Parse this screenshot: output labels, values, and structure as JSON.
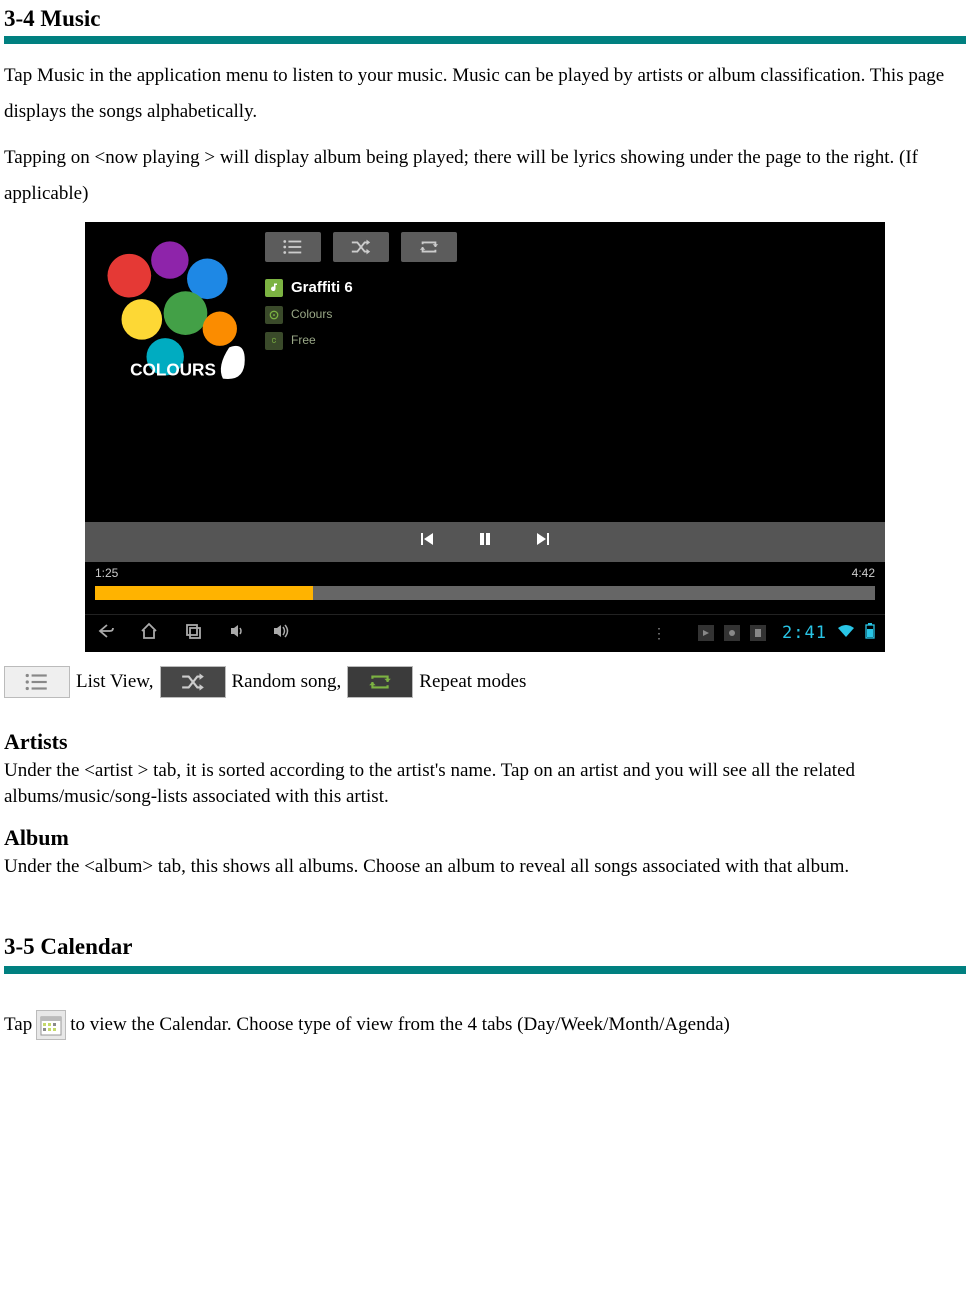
{
  "section1": {
    "title": "3-4 Music",
    "para1": "Tap Music in the application menu to listen to your music. Music can be played by artists or album classification. This page displays the songs alphabetically.",
    "para2": "Tapping on <now playing > will display album being played; there will be lyrics showing under the page to the right. (If applicable)"
  },
  "player": {
    "artist": "Graffiti 6",
    "album": "Colours",
    "track": "Free",
    "time_elapsed": "1:25",
    "time_total": "4:42",
    "clock": "2:41"
  },
  "legend": {
    "list_view": "List View,",
    "random": "Random song,",
    "repeat": "Repeat modes"
  },
  "artists": {
    "heading": "Artists",
    "body": "Under the <artist > tab, it is sorted according to the artist's name. Tap on an artist and you will see all the related albums/music/song-lists associated with this artist."
  },
  "album": {
    "heading": "Album",
    "body": "Under the <album> tab, this shows all albums.    Choose an album to reveal all songs associated with that album."
  },
  "section2": {
    "title": "3-5 Calendar",
    "line_pre": "Tap",
    "line_post": "to view the Calendar.    Choose type of view from the 4 tabs (Day/Week/Month/Agenda)"
  }
}
